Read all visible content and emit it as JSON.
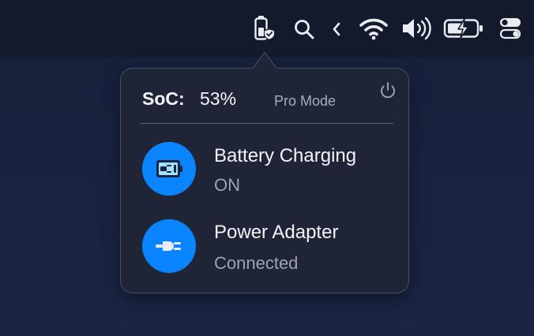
{
  "menubar": {
    "icons": [
      "battery-shield-icon",
      "search-icon",
      "chevron-left-icon",
      "wifi-icon",
      "volume-icon",
      "battery-charging-icon",
      "control-center-icon"
    ]
  },
  "popover": {
    "soc_label": "SoC:",
    "soc_value": "53%",
    "mode": "Pro Mode",
    "power_icon": "power-icon",
    "rows": [
      {
        "title": "Battery Charging",
        "status": "ON",
        "icon": "battery-plug-icon"
      },
      {
        "title": "Power Adapter",
        "status": "Connected",
        "icon": "plug-icon"
      }
    ]
  },
  "colors": {
    "accent": "#0a84ff",
    "menubar_bg": "#131a2c",
    "popover_bg": "#1f2537",
    "desktop_bg": "#1a2544"
  }
}
